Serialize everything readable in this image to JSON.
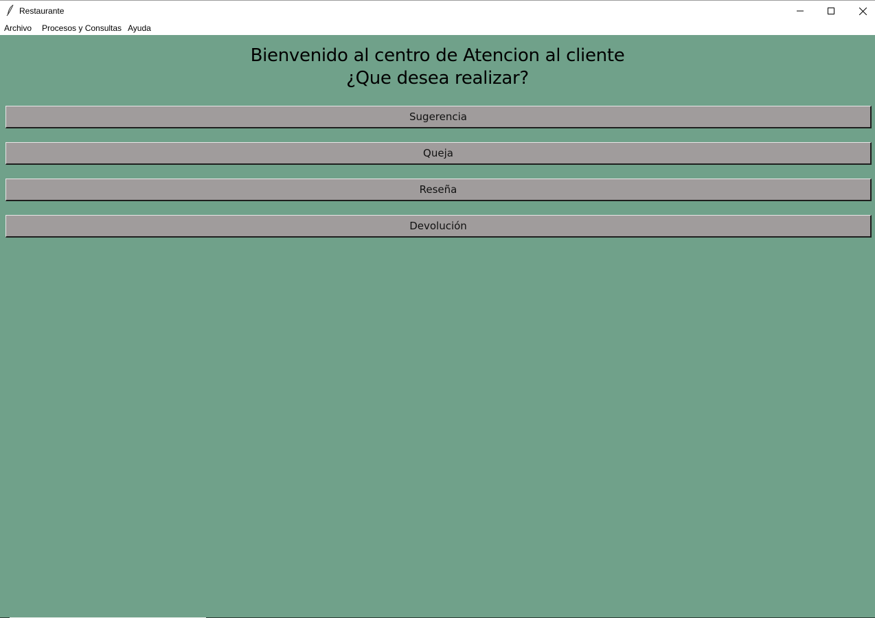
{
  "window": {
    "title": "Restaurante",
    "app_icon": "feather-icon"
  },
  "menubar": {
    "items": [
      "Archivo",
      "Procesos y Consultas",
      "Ayuda"
    ]
  },
  "main": {
    "heading_line1": "Bienvenido al centro de Atencion al cliente",
    "heading_line2": "¿Que desea realizar?",
    "options": [
      "Sugerencia",
      "Queja",
      "Reseña",
      "Devolución"
    ]
  },
  "colors": {
    "background": "#70a18a",
    "button": "#a09c9c"
  }
}
